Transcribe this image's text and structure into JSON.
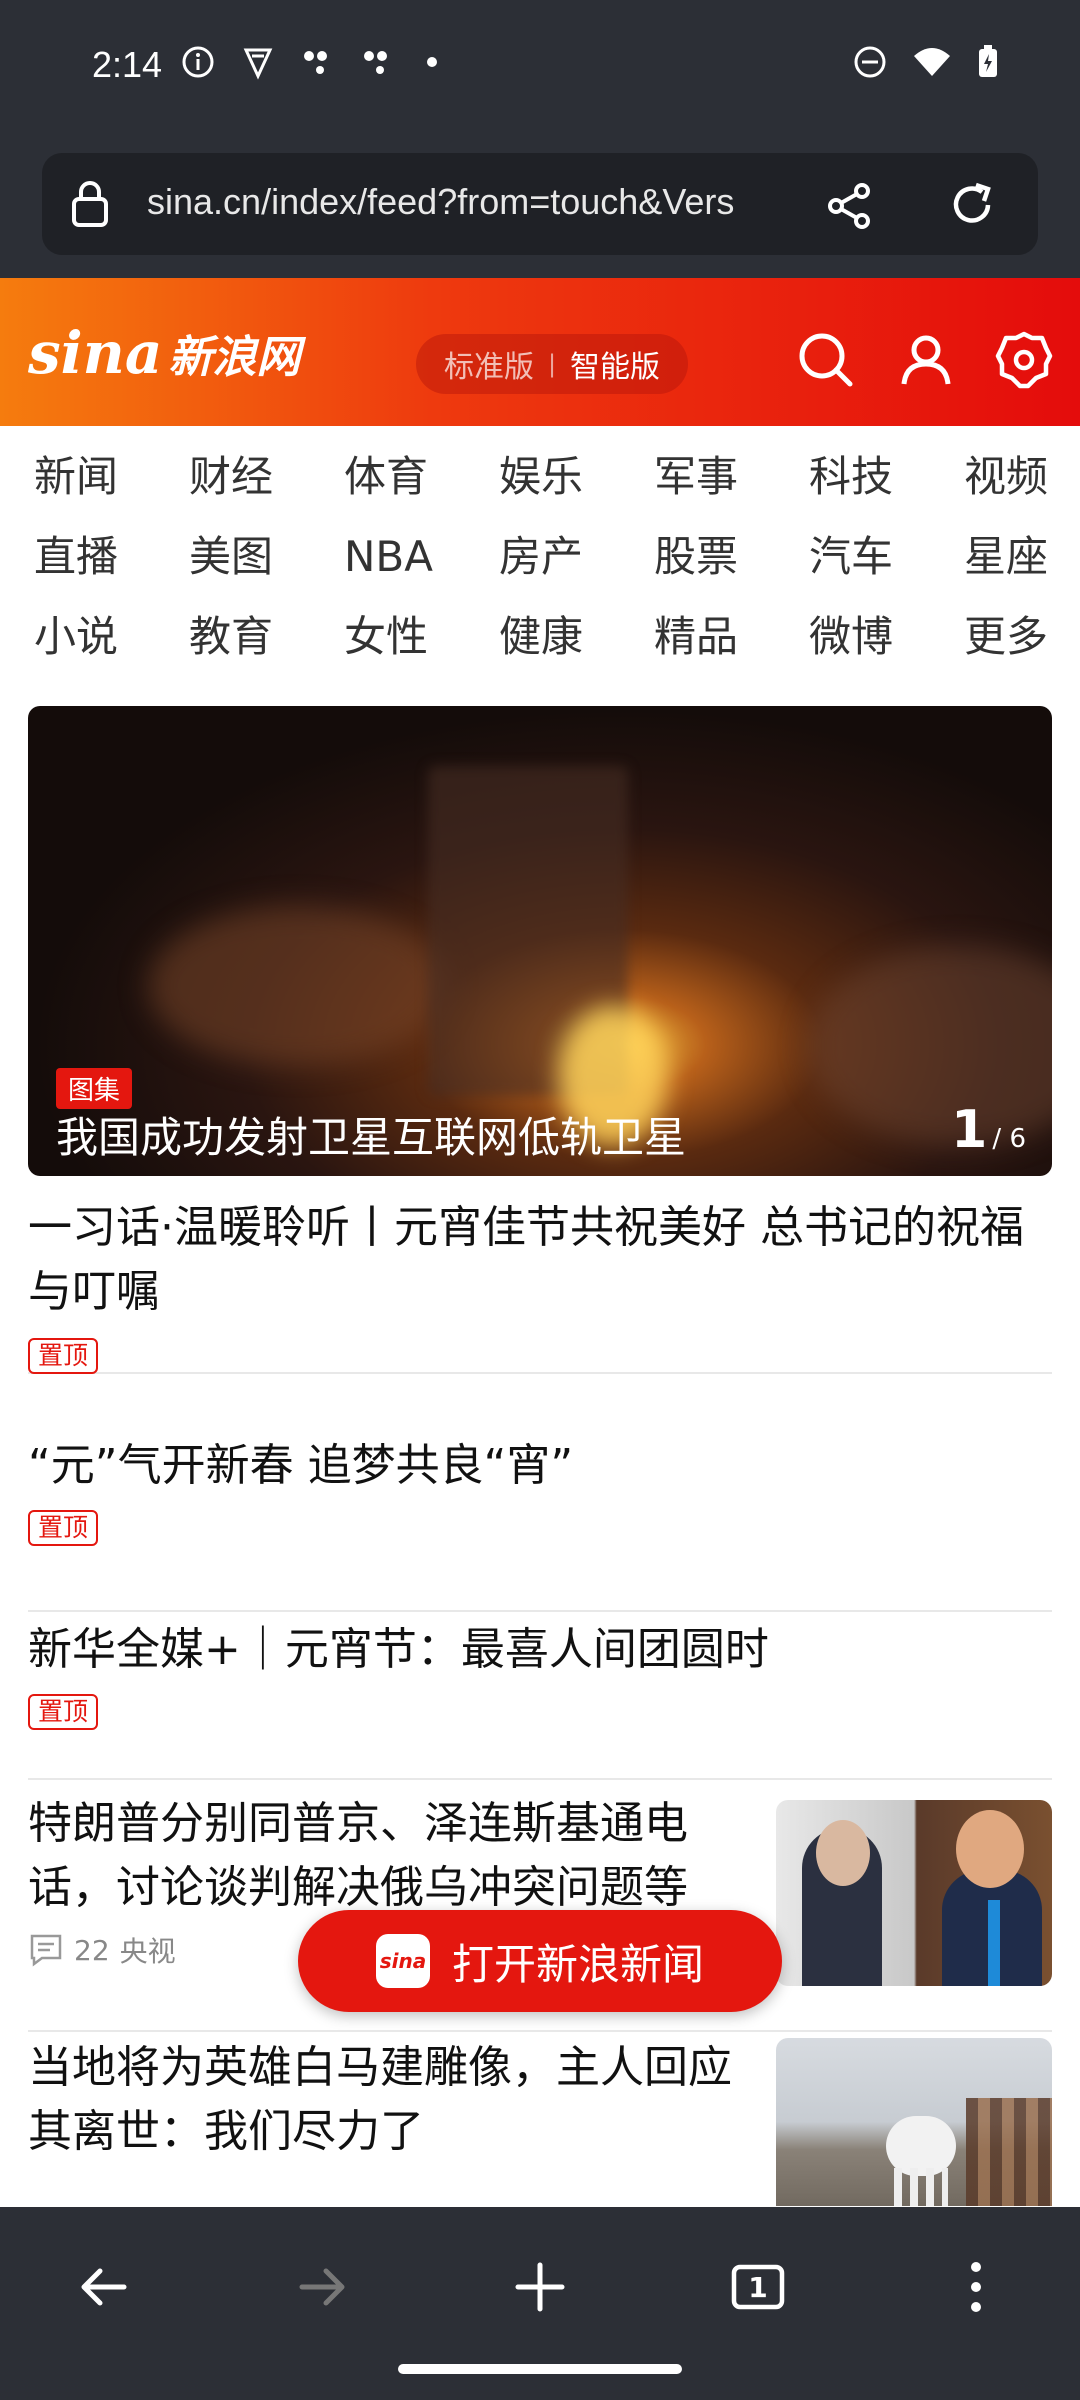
{
  "status": {
    "time": "2:14"
  },
  "browser": {
    "url": "sina.cn/index/feed?from=touch&Vers",
    "tab_count": "1"
  },
  "header": {
    "logo_en": "sina",
    "logo_cn": "新浪网",
    "version_standard": "标准版",
    "version_separator": "|",
    "version_smart": "智能版"
  },
  "nav": [
    "新闻",
    "财经",
    "体育",
    "娱乐",
    "军事",
    "科技",
    "视频",
    "直播",
    "美图",
    "NBA",
    "房产",
    "股票",
    "汽车",
    "星座",
    "小说",
    "教育",
    "女性",
    "健康",
    "精品",
    "微博",
    "更多"
  ],
  "hero": {
    "tag": "图集",
    "title": "我国成功发射卫星互联网低轨卫星",
    "page_current": "1",
    "page_total": "/ 6"
  },
  "articles": [
    {
      "title": "一习话·温暖聆听丨元宵佳节共祝美好 总书记的祝福与叮嘱",
      "badge": "置顶"
    },
    {
      "title": "“元”气开新春 追梦共良“宵”",
      "badge": "置顶"
    },
    {
      "title": "新华全媒+｜元宵节：最喜人间团圆时",
      "badge": "置顶"
    },
    {
      "title": "特朗普分别同普京、泽连斯基通电话，讨论谈判解决俄乌冲突问题等",
      "comments": "22",
      "source": "央视"
    },
    {
      "title": "当地将为英雄白马建雕像，主人回应其离世：我们尽力了"
    }
  ],
  "float_button": {
    "label": "打开新浪新闻",
    "logo": "sina"
  },
  "colors": {
    "brand_red": "#e4170f",
    "brand_orange": "#f57c0e",
    "chrome_dark": "#2c2f36"
  }
}
